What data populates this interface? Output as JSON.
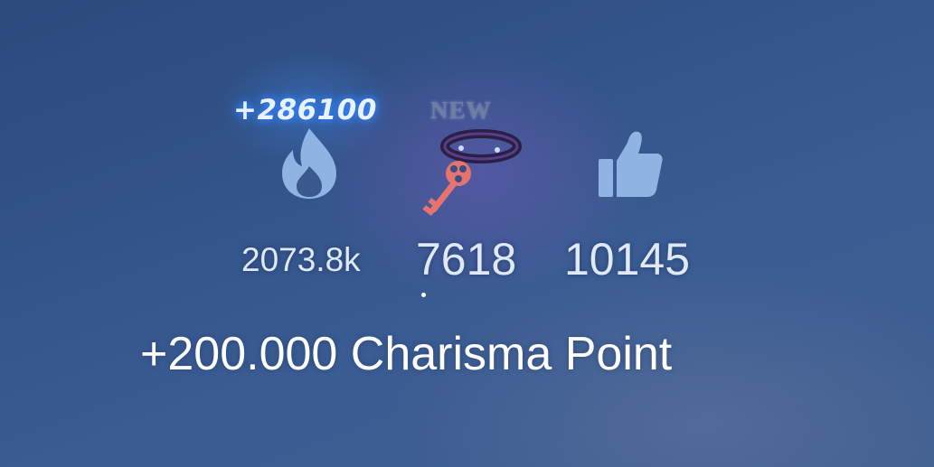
{
  "stats": {
    "popularity": {
      "icon": "flame-icon",
      "bonus": "+286100",
      "value": "2073.8k"
    },
    "item": {
      "icon": "key-icon",
      "badge": "NEW",
      "value": "7618"
    },
    "likes": {
      "icon": "thumbs-up-icon",
      "value": "10145"
    }
  },
  "reward": {
    "text": "+200.000 Charisma Point"
  },
  "colors": {
    "background": "#33548a",
    "icon": "#8fb3e2",
    "bonus_glow": "#3b8cff",
    "key": "#e5736f"
  }
}
